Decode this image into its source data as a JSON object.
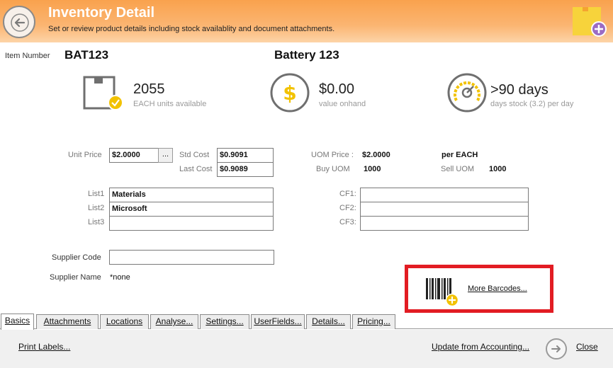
{
  "header": {
    "title": "Inventory Detail",
    "subtitle": "Set or review product details including stock availablity and document attachments."
  },
  "item": {
    "number_label": "Item Number",
    "number": "BAT123",
    "name": "Battery 123"
  },
  "stats": {
    "stock": {
      "value": "2055",
      "caption": "EACH units available"
    },
    "value": {
      "value": "$0.00",
      "caption": "value onhand"
    },
    "days": {
      "value": ">90 days",
      "caption": "days stock (3.2) per day"
    }
  },
  "pricing": {
    "unit_price_label": "Unit Price",
    "unit_price": "$2.0000",
    "ellipsis": "...",
    "std_cost_label": "Std Cost",
    "std_cost": "$0.9091",
    "last_cost_label": "Last Cost",
    "last_cost": "$0.9089",
    "uom_price_label": "UOM Price :",
    "uom_price": "$2.0000",
    "per_label": "per EACH",
    "buy_uom_label": "Buy UOM",
    "buy_uom": "1000",
    "sell_uom_label": "Sell UOM",
    "sell_uom": "1000"
  },
  "lists": {
    "list1_label": "List1",
    "list1": "Materials",
    "list2_label": "List2",
    "list2": "Microsoft",
    "list3_label": "List3",
    "list3": "",
    "cf1_label": "CF1:",
    "cf1": "",
    "cf2_label": "CF2:",
    "cf2": "",
    "cf3_label": "CF3:",
    "cf3": ""
  },
  "supplier": {
    "code_label": "Supplier Code",
    "code": "",
    "name_label": "Supplier Name",
    "name": "*none"
  },
  "barcodes": {
    "link": "More Barcodes..."
  },
  "tabs": [
    {
      "label": "Basics"
    },
    {
      "label": "Attachments"
    },
    {
      "label": "Locations"
    },
    {
      "label": "Analyse..."
    },
    {
      "label": "Settings..."
    },
    {
      "label": "UserFields..."
    },
    {
      "label": "Details..."
    },
    {
      "label": "Pricing..."
    }
  ],
  "footer": {
    "print_labels": "Print Labels...",
    "update": "Update from Accounting...",
    "close": "Close"
  },
  "colors": {
    "header_orange": "#f9a24d",
    "accent_yellow": "#f2c200",
    "highlight_red": "#e21c23"
  },
  "icons": [
    "back-arrow-icon",
    "sticky-note-add-icon",
    "box-check-icon",
    "dollar-icon",
    "gauge-icon",
    "barcode-add-icon",
    "forward-arrow-icon"
  ]
}
